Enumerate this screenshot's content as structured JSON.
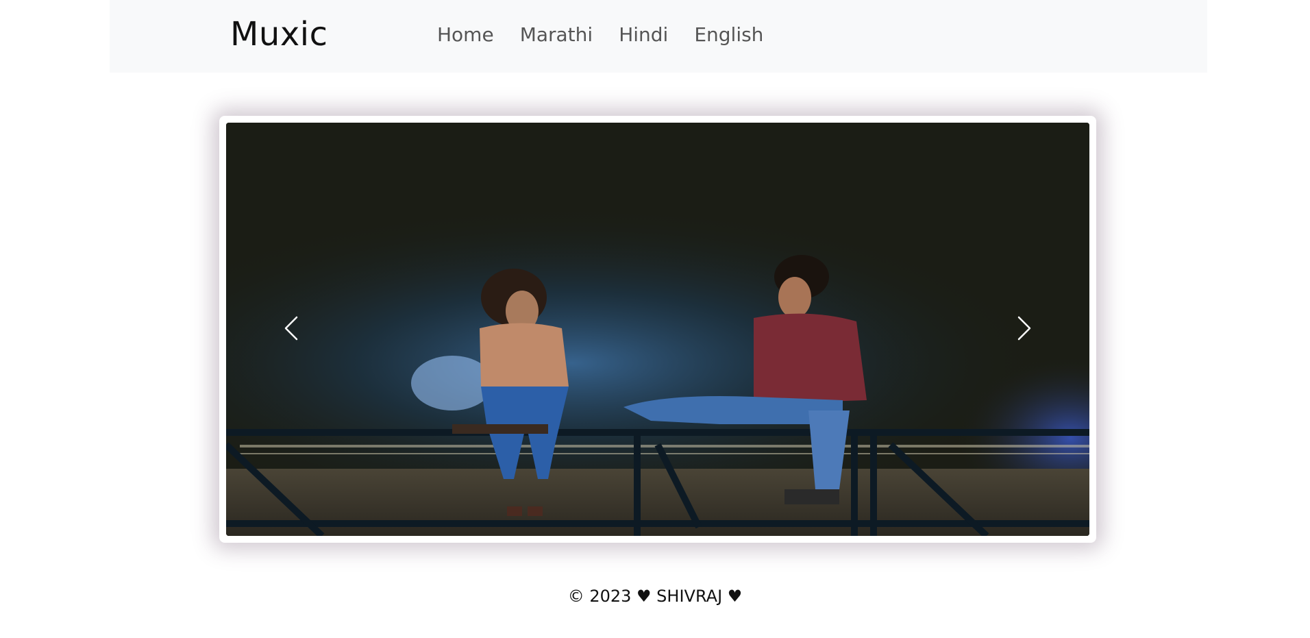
{
  "navbar": {
    "brand": "Muxic",
    "links": [
      {
        "label": "Home"
      },
      {
        "label": "Marathi"
      },
      {
        "label": "Hindi"
      },
      {
        "label": "English"
      }
    ]
  },
  "carousel": {
    "prev_icon": "chevron-left-icon",
    "next_icon": "chevron-right-icon"
  },
  "footer": {
    "text": "© 2023 ♥ SHIVRAJ ♥"
  },
  "colors": {
    "navbar_bg": "#f8f9fa",
    "brand_text": "#111111",
    "nav_link": "#555555"
  }
}
